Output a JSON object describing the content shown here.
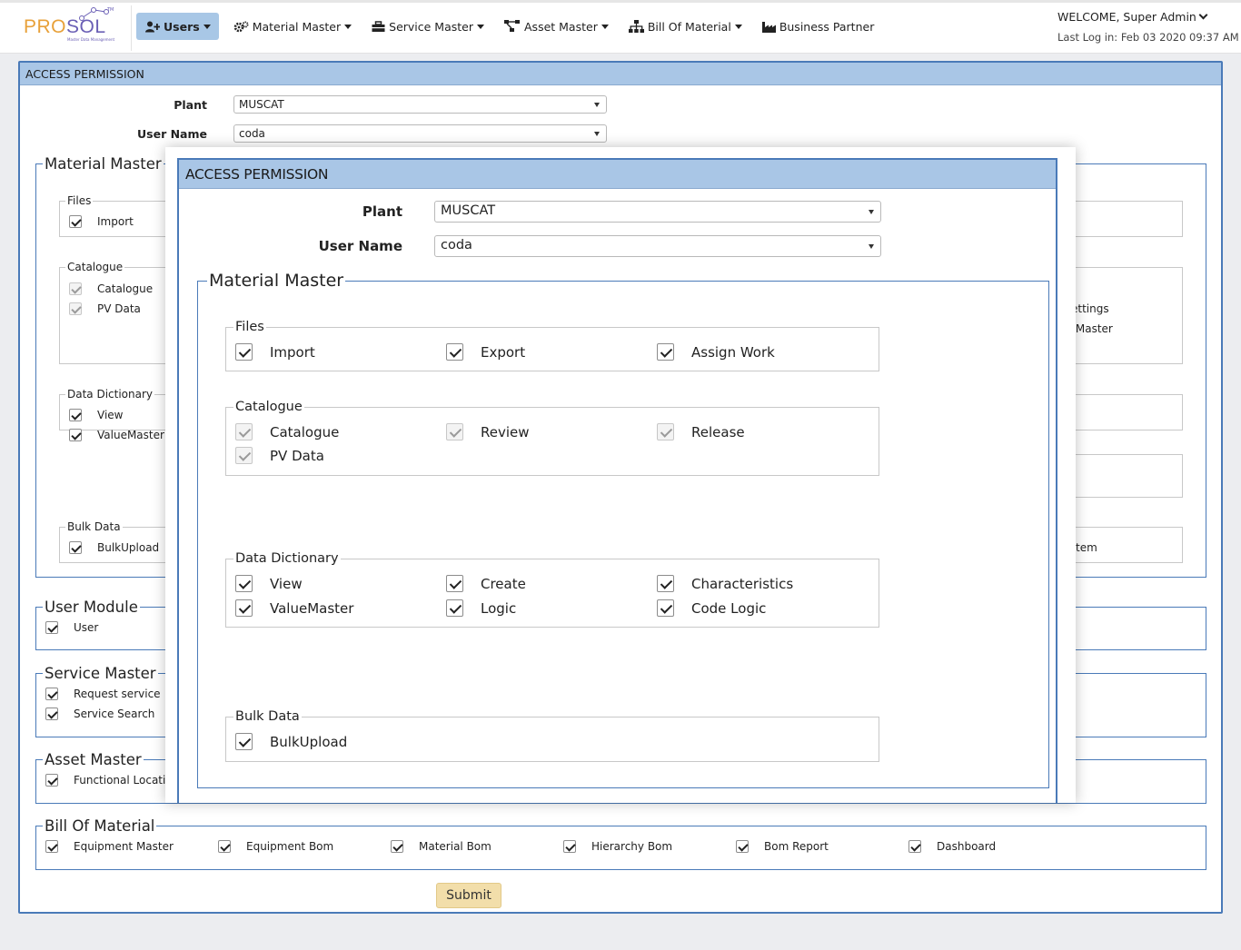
{
  "app": {
    "logo_pro": "PRO",
    "logo_sol": "SOL",
    "logo_tm": "TM",
    "logo_tagline": "Master Data Management"
  },
  "nav": {
    "items": [
      {
        "label": "Users",
        "icon": "user-plus-icon",
        "dropdown": true,
        "active": true
      },
      {
        "label": "Material Master",
        "icon": "gears-icon",
        "dropdown": true
      },
      {
        "label": "Service Master",
        "icon": "toolbox-icon",
        "dropdown": true
      },
      {
        "label": "Asset Master",
        "icon": "project-diagram-icon",
        "dropdown": true
      },
      {
        "label": "Bill Of Material",
        "icon": "sitemap-icon",
        "dropdown": true
      },
      {
        "label": "Business Partner",
        "icon": "industry-icon",
        "dropdown": false
      }
    ]
  },
  "user": {
    "welcome": "WELCOME, Super Admin",
    "last_login": "Last Log in: Feb 03 2020 09:37 AM"
  },
  "panel": {
    "title": "ACCESS PERMISSION",
    "plant_label": "Plant",
    "plant_value": "MUSCAT",
    "user_label": "User Name",
    "user_value": "coda",
    "submit_label": "Submit"
  },
  "background": {
    "material_master": {
      "legend": "Material Master",
      "files": {
        "legend": "Files",
        "items": [
          "Import"
        ]
      },
      "catalogue": {
        "legend": "Catalogue",
        "items": [
          "Catalogue",
          "PV Data"
        ]
      },
      "data_dictionary": {
        "legend": "Data Dictionary",
        "items": [
          "View",
          "ValueMaster"
        ]
      },
      "bulk_data": {
        "legend": "Bulk Data",
        "items": [
          "BulkUpload"
        ]
      },
      "right_fragments": [
        "ettings",
        ": Master",
        "tem"
      ]
    },
    "user_module": {
      "legend": "User Module",
      "items": [
        "User"
      ]
    },
    "service_master": {
      "legend": "Service Master",
      "items": [
        "Request service",
        "Service Search"
      ]
    },
    "asset_master": {
      "legend": "Asset Master",
      "items": [
        "Functional Locatio"
      ]
    },
    "bill_of_material": {
      "legend": "Bill Of Material",
      "items": [
        "Equipment Master",
        "Equipment Bom",
        "Material Bom",
        "Hierarchy Bom",
        "Bom Report",
        "Dashboard"
      ]
    }
  },
  "modal": {
    "title": "ACCESS PERMISSION",
    "plant_label": "Plant",
    "plant_value": "MUSCAT",
    "user_label": "User Name",
    "user_value": "coda",
    "section_legend": "Material Master",
    "files": {
      "legend": "Files",
      "items": [
        "Import",
        "Export",
        "Assign Work"
      ],
      "checked": [
        true,
        true,
        true
      ],
      "disabled": [
        false,
        false,
        false
      ]
    },
    "catalogue": {
      "legend": "Catalogue",
      "items": [
        "Catalogue",
        "Review",
        "Release",
        "PV Data"
      ],
      "checked": [
        true,
        true,
        true,
        true
      ],
      "disabled": [
        true,
        true,
        true,
        true
      ]
    },
    "data_dictionary": {
      "legend": "Data Dictionary",
      "items": [
        "View",
        "Create",
        "Characteristics",
        "ValueMaster",
        "Logic",
        "Code Logic"
      ],
      "checked": [
        true,
        true,
        true,
        true,
        true,
        true
      ],
      "disabled": [
        false,
        false,
        false,
        false,
        false,
        false
      ]
    },
    "bulk_data": {
      "legend": "Bulk Data",
      "items": [
        "BulkUpload"
      ],
      "checked": [
        true
      ],
      "disabled": [
        false
      ]
    }
  },
  "colors": {
    "accent": "#4a7ab8",
    "header_bg": "#a9c6e6",
    "nav_active": "#a8c7e6",
    "submit_bg": "#f2deaa",
    "logo_orange": "#e8a13a",
    "logo_purple": "#6a5fb5"
  }
}
